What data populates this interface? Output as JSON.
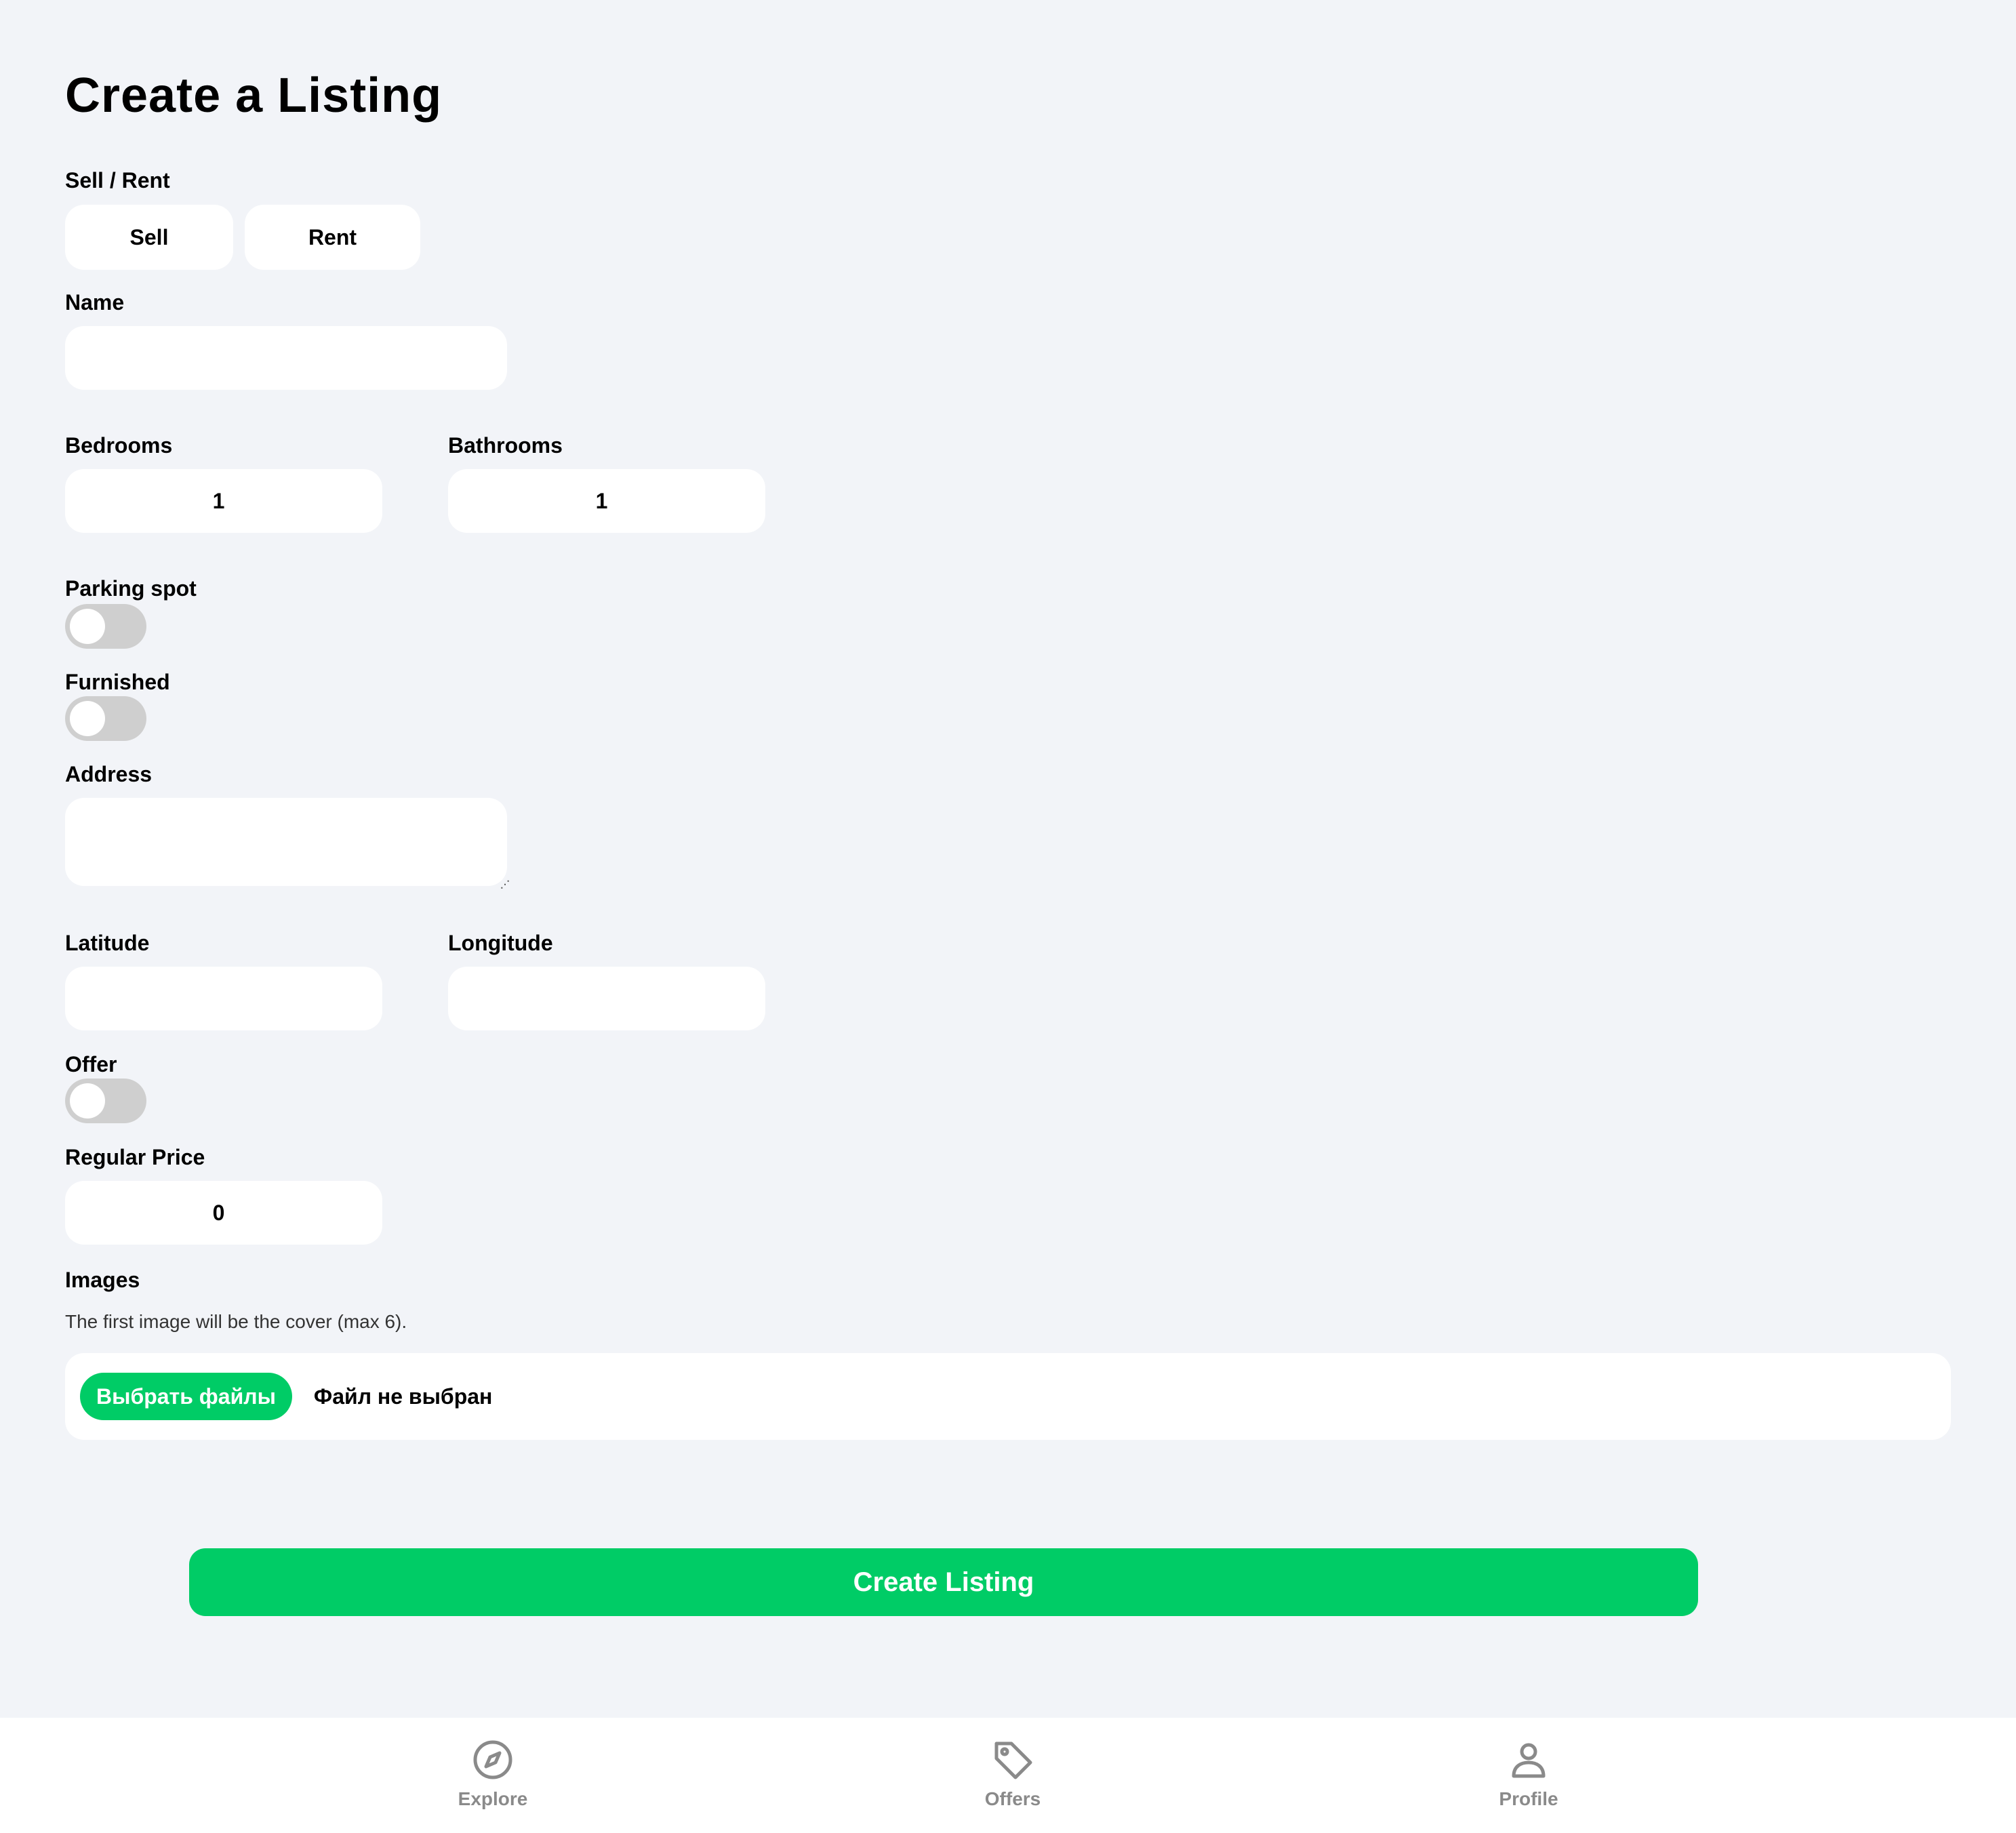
{
  "page": {
    "title": "Create a Listing"
  },
  "form": {
    "sell_rent": {
      "label": "Sell / Rent",
      "options": [
        "Sell",
        "Rent"
      ]
    },
    "name": {
      "label": "Name",
      "value": ""
    },
    "bedrooms": {
      "label": "Bedrooms",
      "value": "1"
    },
    "bathrooms": {
      "label": "Bathrooms",
      "value": "1"
    },
    "parking": {
      "label": "Parking spot",
      "on": false
    },
    "furnished": {
      "label": "Furnished",
      "on": false
    },
    "address": {
      "label": "Address",
      "value": ""
    },
    "latitude": {
      "label": "Latitude",
      "value": ""
    },
    "longitude": {
      "label": "Longitude",
      "value": ""
    },
    "offer": {
      "label": "Offer",
      "on": false
    },
    "regular_price": {
      "label": "Regular Price",
      "value": "0"
    },
    "images": {
      "label": "Images",
      "hint": "The first image will be the cover (max 6).",
      "choose_button": "Выбрать файлы",
      "status": "Файл не выбран"
    },
    "submit_label": "Create Listing"
  },
  "navbar": {
    "items": [
      {
        "label": "Explore",
        "icon": "compass-icon"
      },
      {
        "label": "Offers",
        "icon": "tag-icon"
      },
      {
        "label": "Profile",
        "icon": "person-icon"
      }
    ]
  },
  "colors": {
    "accent": "#00cc66",
    "background": "#f2f4f8",
    "toggle_off": "#cfcfcf",
    "nav_inactive": "#8a8a8a"
  }
}
